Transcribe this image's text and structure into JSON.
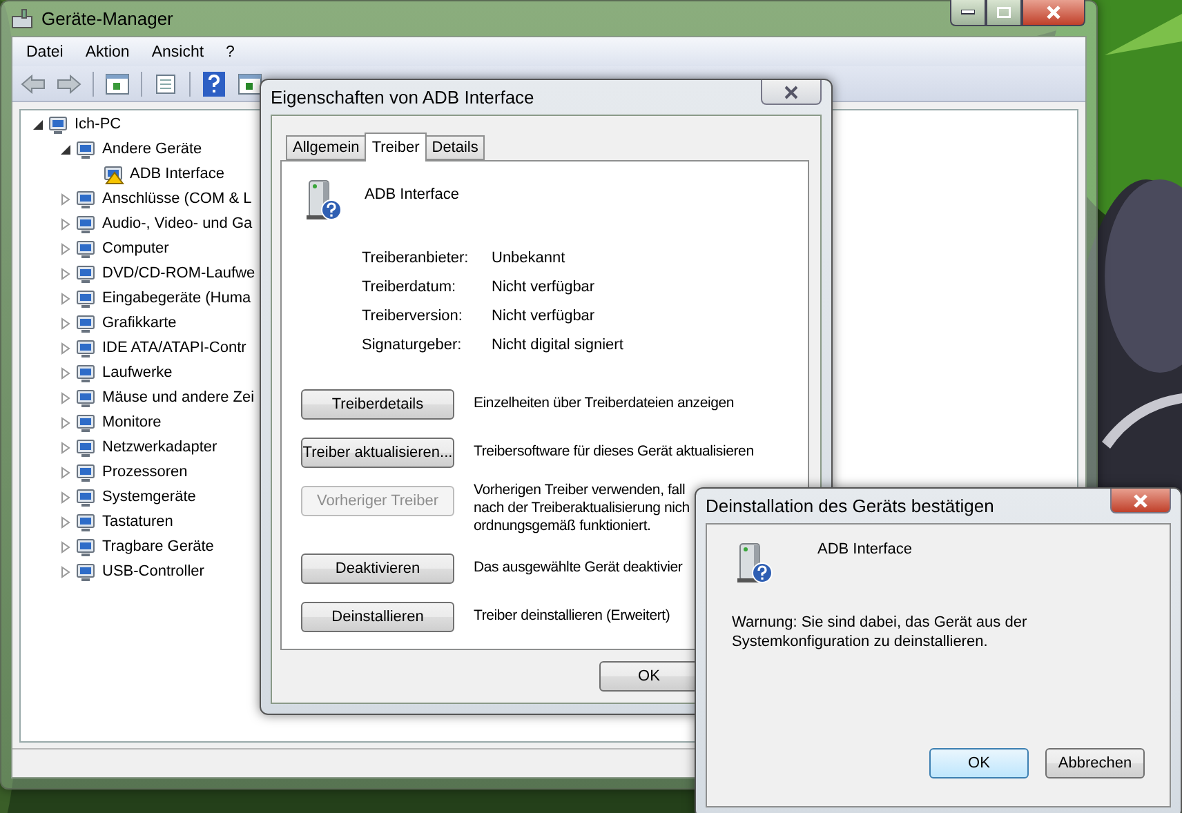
{
  "device_manager": {
    "title": "Geräte-Manager",
    "menu": [
      "Datei",
      "Aktion",
      "Ansicht",
      "?"
    ],
    "tree": [
      {
        "label": "Ich-PC",
        "expanded": true,
        "children": [
          {
            "label": "Andere Geräte",
            "expanded": true,
            "children": [
              {
                "label": "ADB Interface",
                "warning": true
              }
            ]
          },
          {
            "label": "Anschlüsse (COM & L",
            "expanded": false
          },
          {
            "label": "Audio-, Video- und Ga",
            "expanded": false
          },
          {
            "label": "Computer",
            "expanded": false
          },
          {
            "label": "DVD/CD-ROM-Laufwe",
            "expanded": false
          },
          {
            "label": "Eingabegeräte (Huma",
            "expanded": false
          },
          {
            "label": "Grafikkarte",
            "expanded": false
          },
          {
            "label": "IDE ATA/ATAPI-Contr",
            "expanded": false
          },
          {
            "label": "Laufwerke",
            "expanded": false
          },
          {
            "label": "Mäuse und andere Zei",
            "expanded": false
          },
          {
            "label": "Monitore",
            "expanded": false
          },
          {
            "label": "Netzwerkadapter",
            "expanded": false
          },
          {
            "label": "Prozessoren",
            "expanded": false
          },
          {
            "label": "Systemgeräte",
            "expanded": false
          },
          {
            "label": "Tastaturen",
            "expanded": false
          },
          {
            "label": "Tragbare Geräte",
            "expanded": false
          },
          {
            "label": "USB-Controller",
            "expanded": false
          }
        ]
      }
    ]
  },
  "properties": {
    "title": "Eigenschaften von ADB Interface",
    "tabs": [
      {
        "label": "Allgemein",
        "selected": false
      },
      {
        "label": "Treiber",
        "selected": true
      },
      {
        "label": "Details",
        "selected": false
      }
    ],
    "device_name": "ADB Interface",
    "fields": [
      {
        "label": "Treiberanbieter:",
        "value": "Unbekannt"
      },
      {
        "label": "Treiberdatum:",
        "value": "Nicht verfügbar"
      },
      {
        "label": "Treiberversion:",
        "value": "Nicht verfügbar"
      },
      {
        "label": "Signaturgeber:",
        "value": "Nicht digital signiert"
      }
    ],
    "actions": [
      {
        "button": "Treiberdetails",
        "disabled": false,
        "description": [
          "Einzelheiten über Treiberdateien anzeigen"
        ]
      },
      {
        "button": "Treiber aktualisieren...",
        "disabled": false,
        "description": [
          "Treibersoftware für dieses Gerät aktualisieren"
        ]
      },
      {
        "button": "Vorheriger Treiber",
        "disabled": true,
        "description": [
          "Vorherigen Treiber verwenden, fall",
          "nach der Treiberaktualisierung nich",
          "ordnungsgemäß funktioniert."
        ]
      },
      {
        "button": "Deaktivieren",
        "disabled": false,
        "description": [
          "Das ausgewählte Gerät deaktivier"
        ]
      },
      {
        "button": "Deinstallieren",
        "disabled": false,
        "description": [
          "Treiber deinstallieren (Erweitert)"
        ]
      }
    ],
    "ok": "OK"
  },
  "confirm": {
    "title": "Deinstallation des Geräts bestätigen",
    "device_name": "ADB Interface",
    "warning": "Warnung: Sie sind dabei, das Gerät aus der Systemkonfiguration zu deinstallieren.",
    "buttons": [
      {
        "label": "OK",
        "default": true
      },
      {
        "label": "Abbrechen",
        "default": false
      }
    ]
  }
}
